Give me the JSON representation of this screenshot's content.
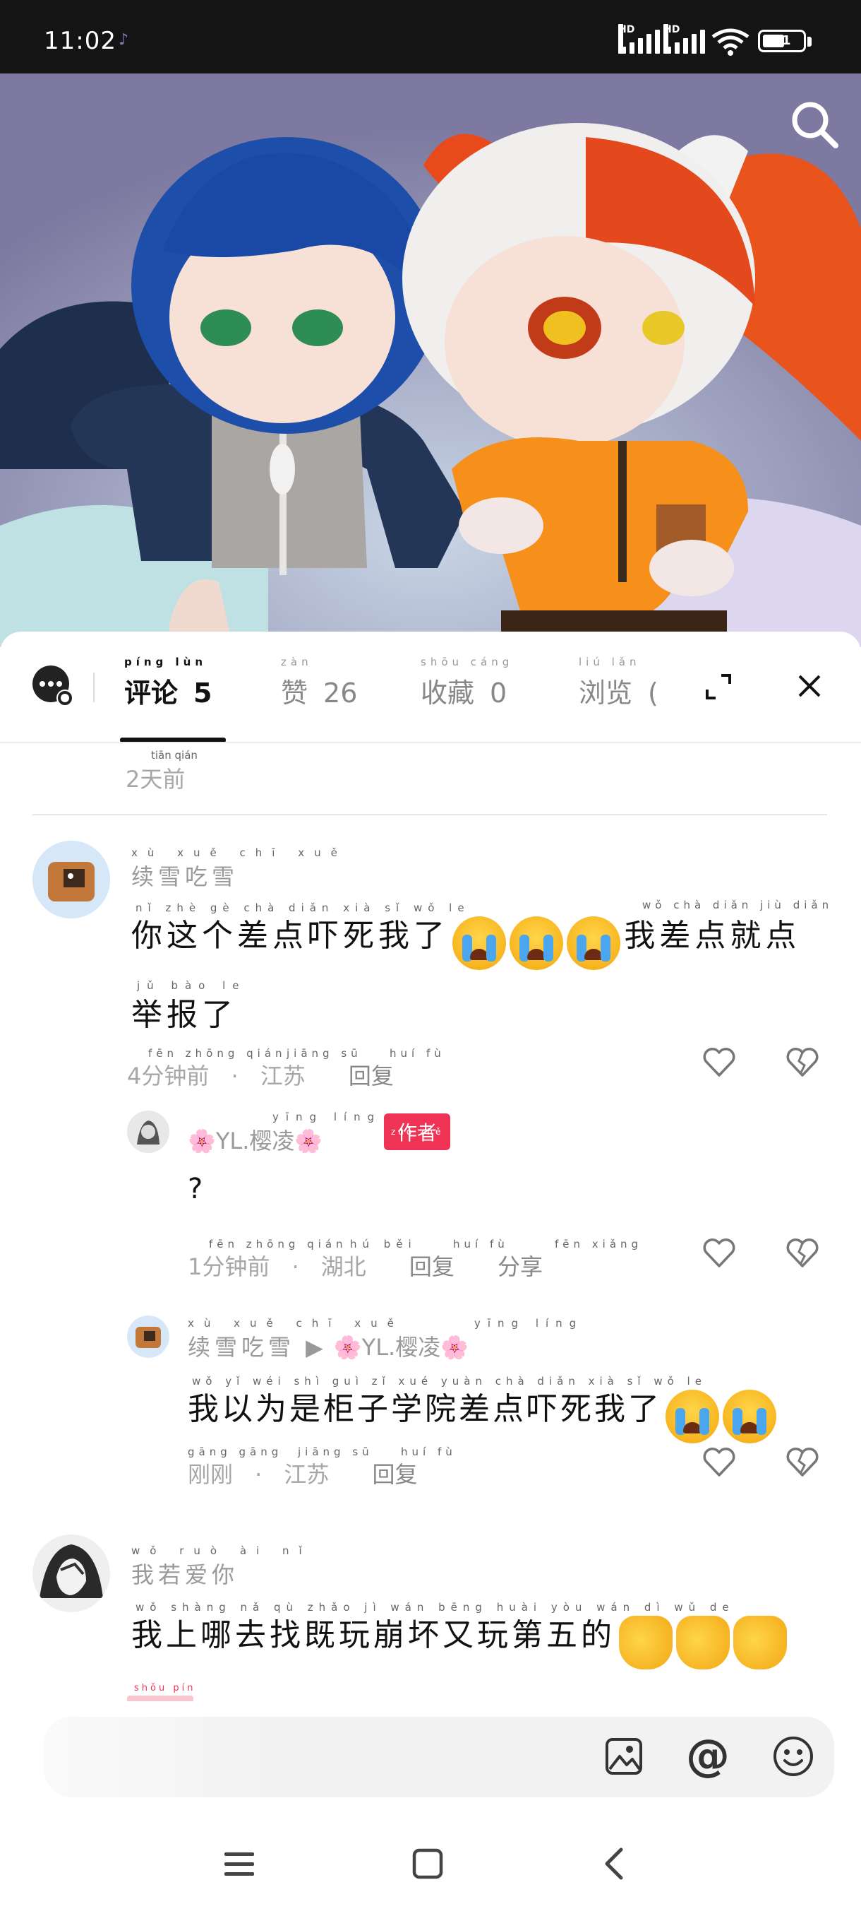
{
  "status_bar": {
    "time": "11:02",
    "battery": "51",
    "signal_labels": [
      "HD",
      "HD"
    ]
  },
  "tabs": [
    {
      "label": "评论",
      "pinyin": "píng lùn",
      "count": "5"
    },
    {
      "label": "赞",
      "pinyin": "zàn",
      "count": "26"
    },
    {
      "label": "收藏",
      "pinyin": "shōu cáng",
      "count": "0"
    },
    {
      "label": "浏览",
      "pinyin": "liú lǎn",
      "count": "("
    }
  ],
  "prev_comment_tail": {
    "time": "2天前",
    "pinyin": "tiān qián"
  },
  "comments": [
    {
      "name": "续雪吃雪",
      "name_pinyin": "xù xuě chī xuě",
      "line1": "你这个差点吓死我了",
      "line1_pinyin": "nǐ zhè gè chà diǎn xià sǐ wǒ le",
      "line1_tail": "我差点就点",
      "line1_tail_pinyin": "wǒ chà diǎn jiù diǎn",
      "line2": "举报了",
      "line2_pinyin": "jǔ bào le",
      "time": "4分钟前",
      "time_pinyin": "fēn zhōng qián",
      "location": "江苏",
      "location_pinyin": "jiāng sū",
      "reply": "回复",
      "reply_pinyin": "huí fù"
    }
  ],
  "replies": [
    {
      "name": "🌸YL.樱凌🌸",
      "name_pinyin": "yīng líng",
      "badge": "作者",
      "badge_pinyin": "zuò zhě",
      "text": "?",
      "time": "1分钟前",
      "time_pinyin": "fēn zhōng qián",
      "location": "湖北",
      "location_pinyin": "hú běi",
      "reply": "回复",
      "reply_pinyin": "huí fù",
      "share": "分享",
      "share_pinyin": "fēn xiǎng"
    },
    {
      "name": "续雪吃雪",
      "name_pinyin": "xù xuě chī xuě",
      "to": "🌸YL.樱凌🌸",
      "to_pinyin": "yīng líng",
      "text": "我以为是柜子学院差点吓死我了",
      "text_pinyin": "wǒ yǐ wéi shì guì zǐ xué yuàn chà diǎn xià sǐ wǒ le",
      "time": "刚刚",
      "time_pinyin": "gāng gāng",
      "location": "江苏",
      "location_pinyin": "jiāng sū",
      "reply": "回复",
      "reply_pinyin": "huí fù"
    }
  ],
  "third_comment": {
    "name": "我若爱你",
    "name_pinyin": "wǒ ruò ài nǐ",
    "text": "我上哪去找既玩崩坏又玩第五的",
    "text_pinyin": "wǒ shàng nǎ qù zhǎo jì wán bēng huài yòu wán dì wǔ de",
    "cut_pinyin": "shǒu píng"
  },
  "input_bar": {
    "image_icon": "image-icon",
    "mention": "@",
    "emoji_icon": "smile-icon"
  },
  "colors": {
    "accent_red": "#ef3355",
    "muted": "#a7a7a7"
  }
}
